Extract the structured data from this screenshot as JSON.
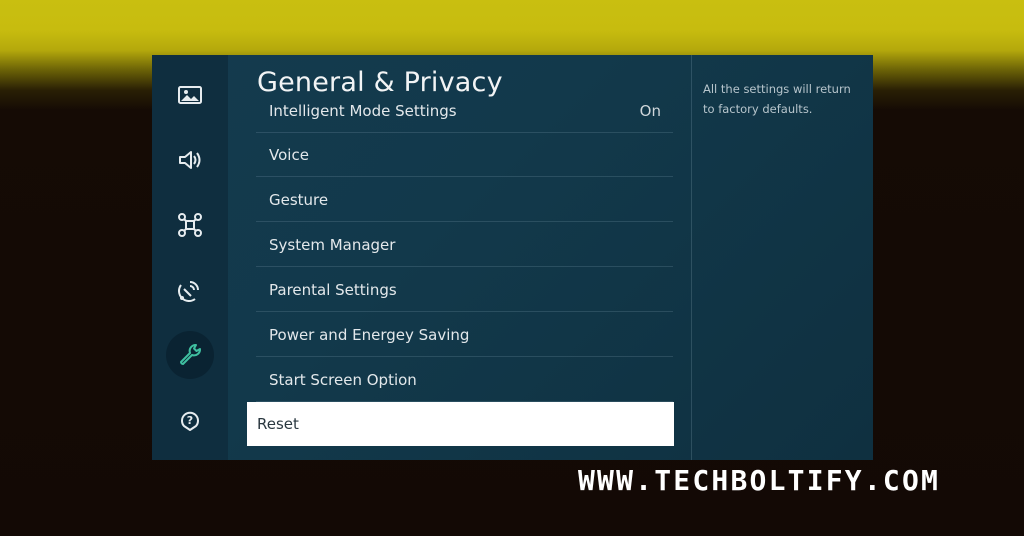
{
  "panel": {
    "title": "General & Privacy",
    "description": "All the settings will return to factory defaults."
  },
  "sidebar": {
    "icons": [
      "picture-icon",
      "sound-icon",
      "connection-icon",
      "broadcasting-icon",
      "wrench-icon",
      "support-icon"
    ],
    "active": "wrench-icon"
  },
  "menu": {
    "items": [
      {
        "label": "Intelligent Mode Settings",
        "value": "On"
      },
      {
        "label": "Voice",
        "value": ""
      },
      {
        "label": "Gesture",
        "value": ""
      },
      {
        "label": "System Manager",
        "value": ""
      },
      {
        "label": "Parental Settings",
        "value": ""
      },
      {
        "label": "Power and Energey Saving",
        "value": ""
      },
      {
        "label": "Start Screen Option",
        "value": ""
      },
      {
        "label": "Reset",
        "value": ""
      }
    ],
    "selected": "Reset"
  },
  "watermark": "WWW.TECHBOLTIFY.COM",
  "colors": {
    "background_top": "#c9bf10",
    "background_bottom": "#130905",
    "panel_bg": "#133849",
    "sidebar_bg": "#0f2e3f",
    "accent_icon": "#3fbfa0",
    "selected_row": "#ffffff"
  }
}
